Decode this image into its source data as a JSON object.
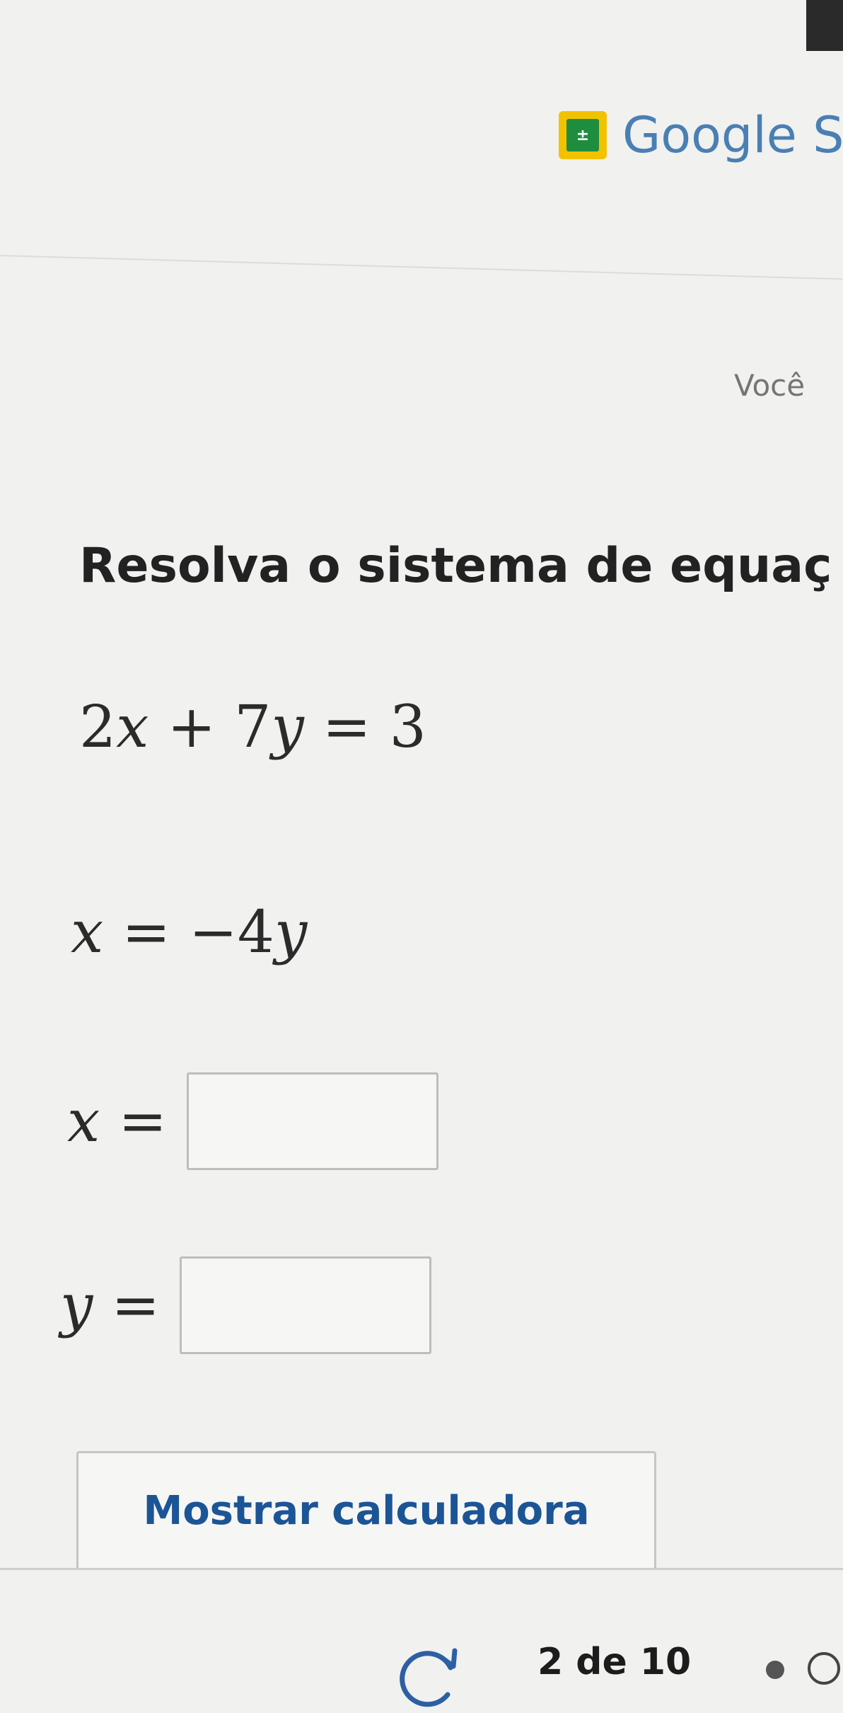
{
  "header": {
    "brand_icon_glyph": "±",
    "brand_text": "Google S",
    "user_label": "Você"
  },
  "question": {
    "prompt": "Resolva o sistema de equaç",
    "equation1": {
      "a": "2",
      "v1": "x",
      "op": " + ",
      "b": "7",
      "v2": "y",
      "rhs": " = 3"
    },
    "equation2": {
      "v": "x",
      "rhs_prefix": " = −4",
      "v2": "y"
    }
  },
  "answers": {
    "x": {
      "label_var": "x",
      "label_eq": " =",
      "value": ""
    },
    "y": {
      "label_var": "y",
      "label_eq": " =",
      "value": ""
    }
  },
  "calculator_button": {
    "label": "Mostrar calculadora"
  },
  "footer": {
    "pager": "2 de 10"
  },
  "colors": {
    "brand_text": "#4a7fb3",
    "link": "#1c5596",
    "brand_icon_outer": "#f2c200",
    "brand_icon_inner": "#1e8e3e"
  }
}
